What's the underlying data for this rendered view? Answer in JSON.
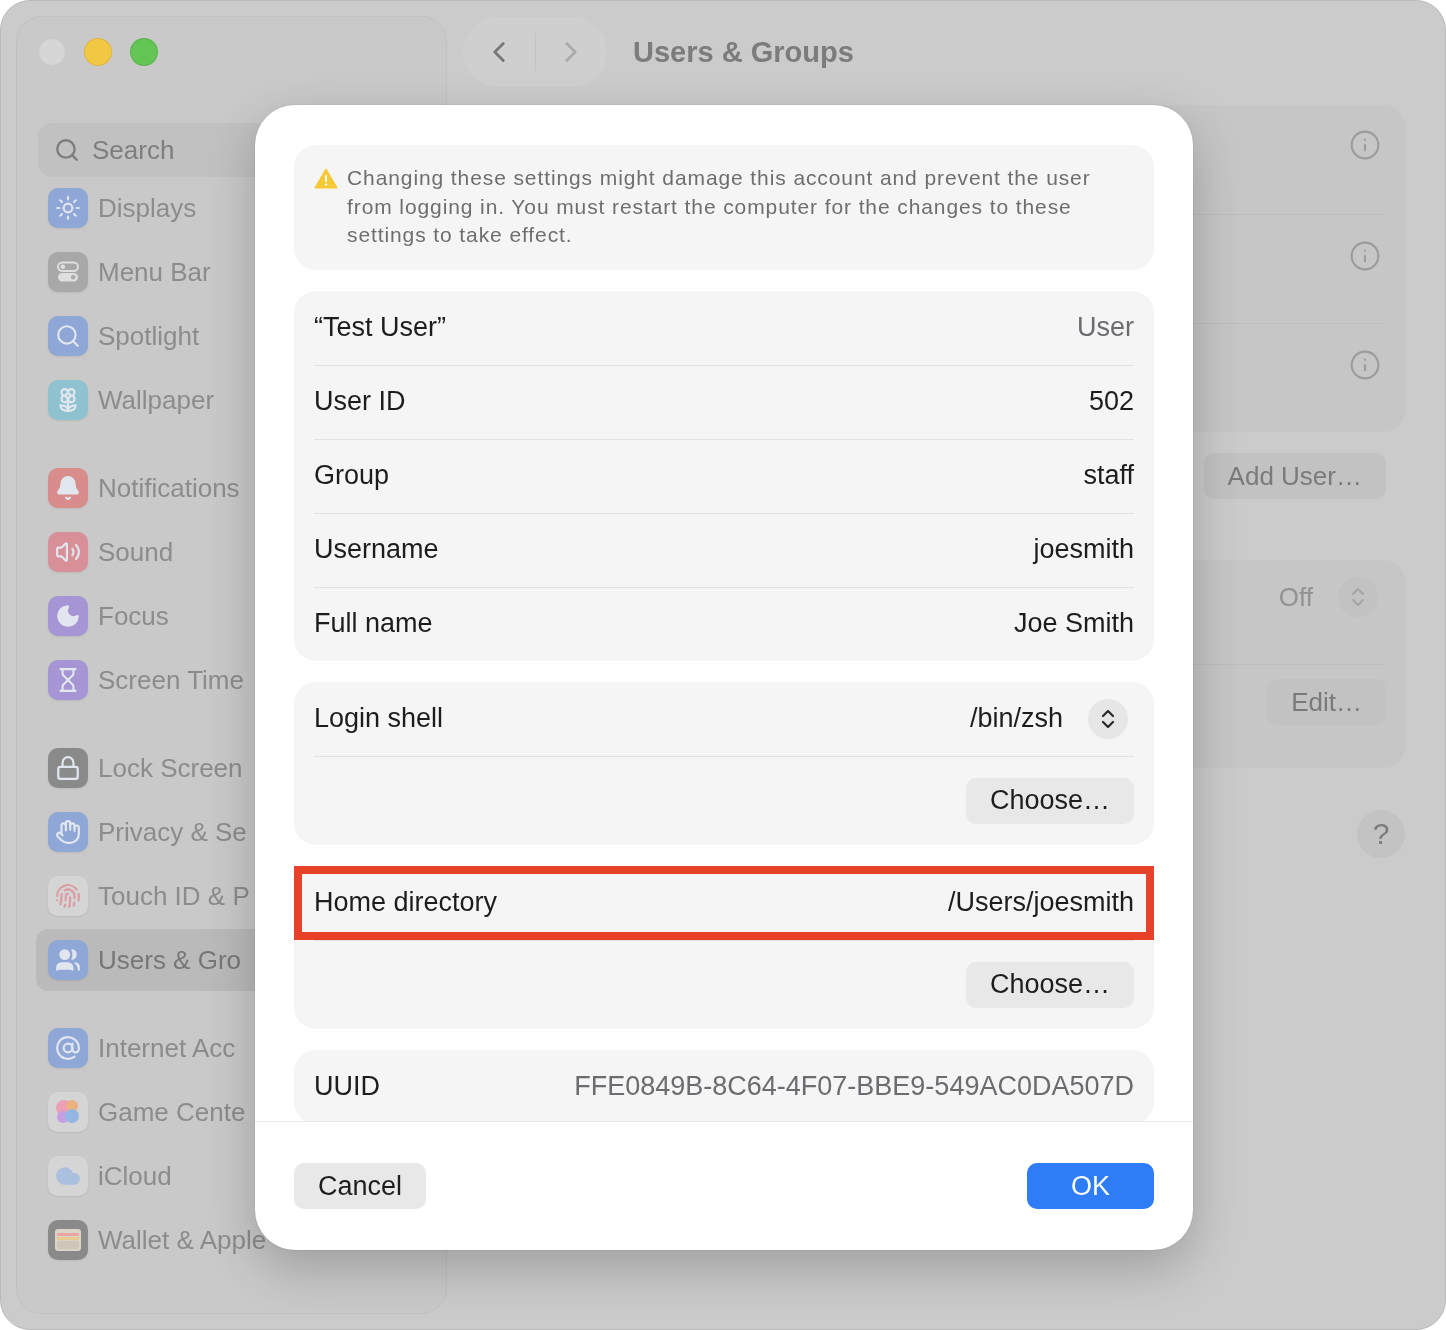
{
  "window_controls": [
    {
      "kind": "close",
      "disabled": true
    },
    {
      "kind": "minimize",
      "disabled": false
    },
    {
      "kind": "zoom",
      "disabled": false
    }
  ],
  "sidebar": {
    "search": {
      "placeholder": "Search"
    },
    "groups": [
      {
        "items": [
          {
            "label": "Displays",
            "selected": false
          },
          {
            "label": "Menu Bar",
            "selected": false
          },
          {
            "label": "Spotlight",
            "selected": false
          },
          {
            "label": "Wallpaper",
            "selected": false
          }
        ]
      },
      {
        "items": [
          {
            "label": "Notifications",
            "selected": false
          },
          {
            "label": "Sound",
            "selected": false
          },
          {
            "label": "Focus",
            "selected": false
          },
          {
            "label": "Screen Time",
            "selected": false
          }
        ]
      },
      {
        "items": [
          {
            "label": "Lock Screen",
            "selected": false
          },
          {
            "label": "Privacy & Se",
            "selected": false
          },
          {
            "label": "Touch ID & P",
            "selected": false
          },
          {
            "label": "Users & Gro",
            "selected": true
          }
        ]
      },
      {
        "items": [
          {
            "label": "Internet Acc",
            "selected": false
          },
          {
            "label": "Game Cente",
            "selected": false
          },
          {
            "label": "iCloud",
            "selected": false
          },
          {
            "label": "Wallet & Apple",
            "selected": false
          }
        ]
      }
    ]
  },
  "toolbar": {
    "back": {
      "disabled": false
    },
    "forward": {
      "disabled": true
    },
    "title": "Users & Groups"
  },
  "content": {
    "card_rows": [
      {
        "info": true
      },
      {
        "info": true
      },
      {
        "info": true
      }
    ],
    "add_user_button": "Add User…",
    "options_card": {
      "popup": {
        "value": "Off",
        "disabled": true
      },
      "edit_button": "Edit…"
    },
    "help_button": "?"
  },
  "dialog": {
    "warning": "Changing these settings might damage this account and prevent the user from logging in. You must restart the computer for the changes to these settings to take effect.",
    "cards": [
      {
        "rows": [
          {
            "kind": "pair",
            "label": "“Test User”",
            "value": "User",
            "dimmed": true,
            "highlighted": false
          },
          {
            "kind": "pair",
            "label": "User ID",
            "value": "502",
            "dimmed": false,
            "highlighted": false
          },
          {
            "kind": "pair",
            "label": "Group",
            "value": "staff",
            "dimmed": false,
            "highlighted": false
          },
          {
            "kind": "pair",
            "label": "Username",
            "value": "joesmith",
            "dimmed": false,
            "highlighted": false
          },
          {
            "kind": "pair",
            "label": "Full name",
            "value": "Joe Smith",
            "dimmed": false,
            "highlighted": false
          }
        ]
      },
      {
        "rows": [
          {
            "kind": "popup",
            "label": "Login shell",
            "value": "/bin/zsh",
            "highlighted": false
          },
          {
            "kind": "button",
            "label": "Choose…"
          }
        ]
      },
      {
        "rows": [
          {
            "kind": "pair",
            "label": "Home directory",
            "value": "/Users/joesmith",
            "dimmed": false,
            "highlighted": true
          },
          {
            "kind": "button",
            "label": "Choose…"
          }
        ]
      },
      {
        "rows": [
          {
            "kind": "pair",
            "label": "UUID",
            "value": "FFE0849B-8C64-4F07-BBE9-549AC0DA507D",
            "dimmed": true,
            "highlighted": false
          }
        ]
      }
    ],
    "buttons": [
      {
        "kind": "plain",
        "label": "Cancel"
      },
      {
        "kind": "default",
        "label": "OK"
      }
    ]
  }
}
